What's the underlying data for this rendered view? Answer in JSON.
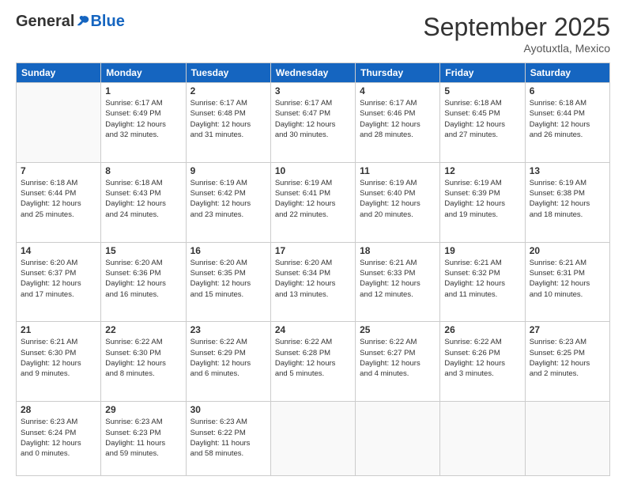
{
  "logo": {
    "general": "General",
    "blue": "Blue"
  },
  "header": {
    "month": "September 2025",
    "location": "Ayotuxtla, Mexico"
  },
  "weekdays": [
    "Sunday",
    "Monday",
    "Tuesday",
    "Wednesday",
    "Thursday",
    "Friday",
    "Saturday"
  ],
  "weeks": [
    [
      {
        "day": "",
        "info": ""
      },
      {
        "day": "1",
        "info": "Sunrise: 6:17 AM\nSunset: 6:49 PM\nDaylight: 12 hours\nand 32 minutes."
      },
      {
        "day": "2",
        "info": "Sunrise: 6:17 AM\nSunset: 6:48 PM\nDaylight: 12 hours\nand 31 minutes."
      },
      {
        "day": "3",
        "info": "Sunrise: 6:17 AM\nSunset: 6:47 PM\nDaylight: 12 hours\nand 30 minutes."
      },
      {
        "day": "4",
        "info": "Sunrise: 6:17 AM\nSunset: 6:46 PM\nDaylight: 12 hours\nand 28 minutes."
      },
      {
        "day": "5",
        "info": "Sunrise: 6:18 AM\nSunset: 6:45 PM\nDaylight: 12 hours\nand 27 minutes."
      },
      {
        "day": "6",
        "info": "Sunrise: 6:18 AM\nSunset: 6:44 PM\nDaylight: 12 hours\nand 26 minutes."
      }
    ],
    [
      {
        "day": "7",
        "info": "Sunrise: 6:18 AM\nSunset: 6:44 PM\nDaylight: 12 hours\nand 25 minutes."
      },
      {
        "day": "8",
        "info": "Sunrise: 6:18 AM\nSunset: 6:43 PM\nDaylight: 12 hours\nand 24 minutes."
      },
      {
        "day": "9",
        "info": "Sunrise: 6:19 AM\nSunset: 6:42 PM\nDaylight: 12 hours\nand 23 minutes."
      },
      {
        "day": "10",
        "info": "Sunrise: 6:19 AM\nSunset: 6:41 PM\nDaylight: 12 hours\nand 22 minutes."
      },
      {
        "day": "11",
        "info": "Sunrise: 6:19 AM\nSunset: 6:40 PM\nDaylight: 12 hours\nand 20 minutes."
      },
      {
        "day": "12",
        "info": "Sunrise: 6:19 AM\nSunset: 6:39 PM\nDaylight: 12 hours\nand 19 minutes."
      },
      {
        "day": "13",
        "info": "Sunrise: 6:19 AM\nSunset: 6:38 PM\nDaylight: 12 hours\nand 18 minutes."
      }
    ],
    [
      {
        "day": "14",
        "info": "Sunrise: 6:20 AM\nSunset: 6:37 PM\nDaylight: 12 hours\nand 17 minutes."
      },
      {
        "day": "15",
        "info": "Sunrise: 6:20 AM\nSunset: 6:36 PM\nDaylight: 12 hours\nand 16 minutes."
      },
      {
        "day": "16",
        "info": "Sunrise: 6:20 AM\nSunset: 6:35 PM\nDaylight: 12 hours\nand 15 minutes."
      },
      {
        "day": "17",
        "info": "Sunrise: 6:20 AM\nSunset: 6:34 PM\nDaylight: 12 hours\nand 13 minutes."
      },
      {
        "day": "18",
        "info": "Sunrise: 6:21 AM\nSunset: 6:33 PM\nDaylight: 12 hours\nand 12 minutes."
      },
      {
        "day": "19",
        "info": "Sunrise: 6:21 AM\nSunset: 6:32 PM\nDaylight: 12 hours\nand 11 minutes."
      },
      {
        "day": "20",
        "info": "Sunrise: 6:21 AM\nSunset: 6:31 PM\nDaylight: 12 hours\nand 10 minutes."
      }
    ],
    [
      {
        "day": "21",
        "info": "Sunrise: 6:21 AM\nSunset: 6:30 PM\nDaylight: 12 hours\nand 9 minutes."
      },
      {
        "day": "22",
        "info": "Sunrise: 6:22 AM\nSunset: 6:30 PM\nDaylight: 12 hours\nand 8 minutes."
      },
      {
        "day": "23",
        "info": "Sunrise: 6:22 AM\nSunset: 6:29 PM\nDaylight: 12 hours\nand 6 minutes."
      },
      {
        "day": "24",
        "info": "Sunrise: 6:22 AM\nSunset: 6:28 PM\nDaylight: 12 hours\nand 5 minutes."
      },
      {
        "day": "25",
        "info": "Sunrise: 6:22 AM\nSunset: 6:27 PM\nDaylight: 12 hours\nand 4 minutes."
      },
      {
        "day": "26",
        "info": "Sunrise: 6:22 AM\nSunset: 6:26 PM\nDaylight: 12 hours\nand 3 minutes."
      },
      {
        "day": "27",
        "info": "Sunrise: 6:23 AM\nSunset: 6:25 PM\nDaylight: 12 hours\nand 2 minutes."
      }
    ],
    [
      {
        "day": "28",
        "info": "Sunrise: 6:23 AM\nSunset: 6:24 PM\nDaylight: 12 hours\nand 0 minutes."
      },
      {
        "day": "29",
        "info": "Sunrise: 6:23 AM\nSunset: 6:23 PM\nDaylight: 11 hours\nand 59 minutes."
      },
      {
        "day": "30",
        "info": "Sunrise: 6:23 AM\nSunset: 6:22 PM\nDaylight: 11 hours\nand 58 minutes."
      },
      {
        "day": "",
        "info": ""
      },
      {
        "day": "",
        "info": ""
      },
      {
        "day": "",
        "info": ""
      },
      {
        "day": "",
        "info": ""
      }
    ]
  ]
}
